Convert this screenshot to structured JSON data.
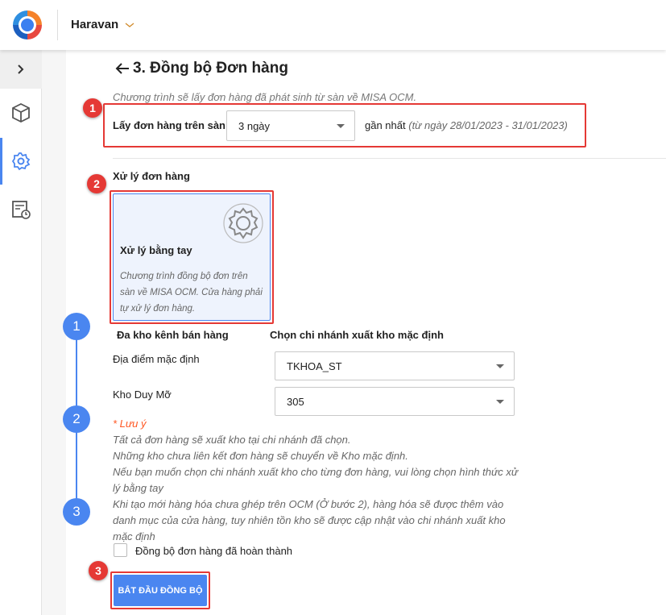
{
  "header": {
    "shop_name": "Haravan"
  },
  "sidebar": {
    "items": [
      {
        "icon": "chevron-right-icon"
      },
      {
        "icon": "box-icon"
      },
      {
        "icon": "gear-icon",
        "active": true
      },
      {
        "icon": "calendar-clock-icon"
      }
    ]
  },
  "page": {
    "title": "3. Đồng bộ Đơn hàng",
    "subtitle": "Chương trình sẽ lấy đơn hàng đã phát sinh từ sàn về MISA OCM."
  },
  "fetch": {
    "label": "Lấy đơn hàng trên sàn",
    "value": "3 ngày",
    "suffix": "gần nhất",
    "range": "(từ ngày 28/01/2023 - 31/01/2023)"
  },
  "processing": {
    "label": "Xử lý đơn hàng",
    "option_title": "Xử lý bằng tay",
    "option_desc": "Chương trình đồng bộ đơn trên sàn về MISA OCM. Cửa hàng phải tự xử lý đơn hàng."
  },
  "warehouse": {
    "col1": "Đa kho kênh bán hàng",
    "col2": "Chọn chi nhánh xuất kho mặc định",
    "rows": [
      {
        "label": "Địa điểm mặc định",
        "value": "TKHOA_ST"
      },
      {
        "label": "Kho Duy Mỡ",
        "value": "305"
      }
    ]
  },
  "note": {
    "title": "* Lưu ý",
    "lines": [
      "Tất cả đơn hàng sẽ xuất kho tại chi nhánh đã chọn.",
      "Những kho chưa liên kết đơn hàng sẽ chuyển về Kho mặc định.",
      "Nếu bạn muốn chọn chi nhánh xuất kho cho từng đơn hàng, vui lòng chọn hình thức xử lý bằng tay",
      "Khi tạo mới hàng hóa chưa ghép trên OCM (Ở bước 2), hàng hóa sẽ được thêm vào danh mục của cửa hàng, tuy nhiên tồn kho sẽ được cập nhật vào chi nhánh xuất kho mặc định"
    ]
  },
  "checkbox": {
    "label": "Đồng bộ đơn hàng đã hoàn thành",
    "checked": false
  },
  "start_button": "BẮT ĐẦU ĐỒNG BỘ",
  "annotations": {
    "badges": [
      "1",
      "2",
      "3"
    ],
    "steps": [
      "1",
      "2",
      "3"
    ]
  },
  "colors": {
    "accent": "#4a86f0",
    "annotation": "#e53935"
  }
}
